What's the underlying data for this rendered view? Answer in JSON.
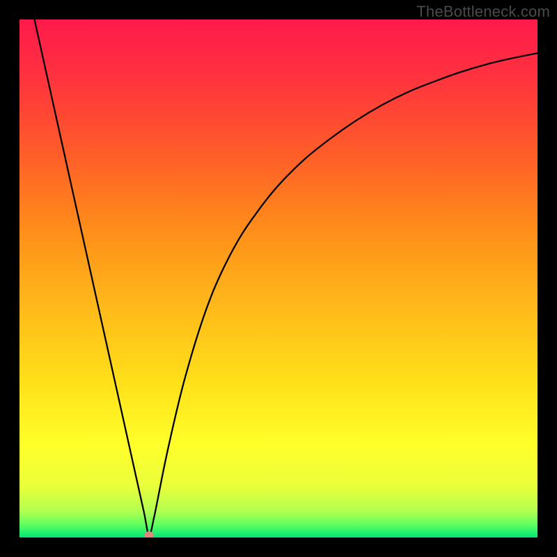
{
  "watermark": "TheBottleneck.com",
  "chart_data": {
    "type": "line",
    "title": "",
    "xlabel": "",
    "ylabel": "",
    "xlim": [
      0,
      100
    ],
    "ylim": [
      0,
      100
    ],
    "x": [
      0,
      2,
      4,
      6,
      8,
      10,
      12,
      14,
      16,
      18,
      20,
      22,
      24,
      25,
      26,
      28,
      30,
      32,
      35,
      38,
      42,
      46,
      50,
      55,
      60,
      65,
      70,
      75,
      80,
      85,
      90,
      95,
      100
    ],
    "values": [
      113,
      104,
      95,
      86,
      77,
      68,
      59,
      50,
      41,
      32,
      23,
      14,
      5,
      0.5,
      4,
      14,
      23,
      31,
      41,
      49,
      57,
      63,
      68,
      73,
      77,
      80.5,
      83.5,
      86,
      88,
      89.8,
      91.3,
      92.5,
      93.5
    ],
    "marker": {
      "x": 25,
      "y": 0.5
    },
    "gradient_stops": [
      {
        "offset": 0.0,
        "color": "#ff1a4b"
      },
      {
        "offset": 0.1,
        "color": "#ff3040"
      },
      {
        "offset": 0.25,
        "color": "#ff5a2a"
      },
      {
        "offset": 0.4,
        "color": "#ff8c1a"
      },
      {
        "offset": 0.55,
        "color": "#ffb81a"
      },
      {
        "offset": 0.7,
        "color": "#ffe01a"
      },
      {
        "offset": 0.82,
        "color": "#ffff2a"
      },
      {
        "offset": 0.9,
        "color": "#eaff3a"
      },
      {
        "offset": 0.95,
        "color": "#b0ff50"
      },
      {
        "offset": 0.975,
        "color": "#60ff60"
      },
      {
        "offset": 1.0,
        "color": "#00e676"
      }
    ]
  }
}
